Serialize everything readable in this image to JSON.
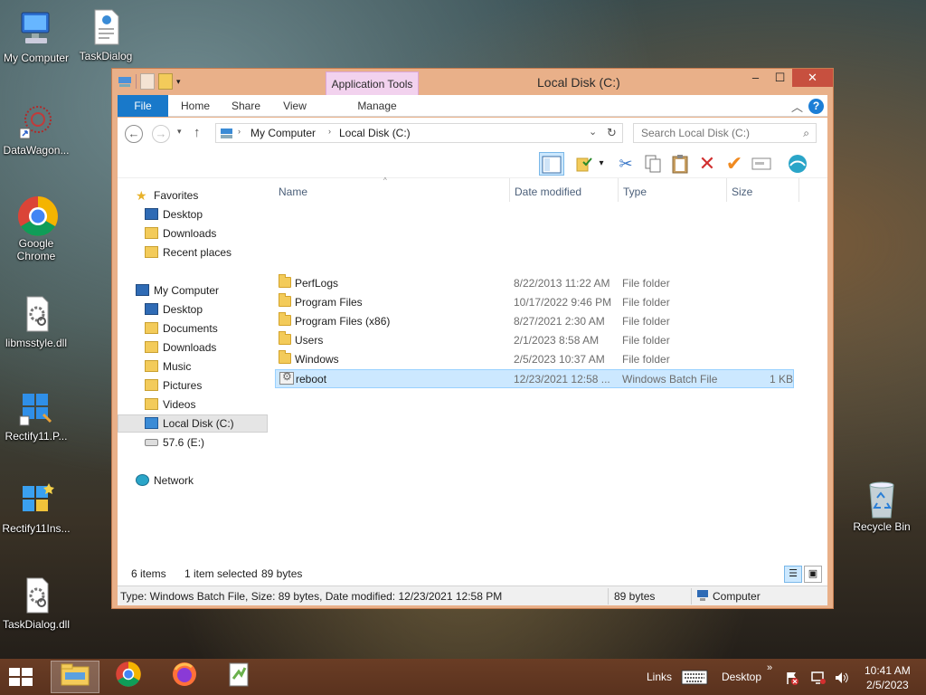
{
  "desktop": {
    "icons": [
      {
        "label": "My Computer"
      },
      {
        "label": "TaskDialog"
      },
      {
        "label": "DataWagon..."
      },
      {
        "label": "Google Chrome"
      },
      {
        "label": "libmsstyle.dll"
      },
      {
        "label": "Rectify11.P..."
      },
      {
        "label": "Rectify11Ins..."
      },
      {
        "label": "TaskDialog.dll"
      },
      {
        "label": "Recycle Bin"
      }
    ]
  },
  "window": {
    "title": "Local Disk (C:)",
    "context_tab": "Application Tools",
    "caption": {
      "minimize": "–",
      "maximize": "☐",
      "close": "✕"
    },
    "ribbon_tabs": [
      "File",
      "Home",
      "Share",
      "View",
      "Manage"
    ],
    "help": "?",
    "address": {
      "breadcrumbs": [
        "My Computer",
        "Local Disk (C:)"
      ],
      "search_placeholder": "Search Local Disk (C:)"
    },
    "columns": [
      "Name",
      "Date modified",
      "Type",
      "Size"
    ],
    "nav": {
      "favorites_header": "Favorites",
      "favorites": [
        "Desktop",
        "Downloads",
        "Recent places"
      ],
      "computer_header": "My Computer",
      "computer": [
        "Desktop",
        "Documents",
        "Downloads",
        "Music",
        "Pictures",
        "Videos",
        "Local Disk (C:)",
        "57.6 (E:)"
      ],
      "network": "Network"
    },
    "files": [
      {
        "name": "PerfLogs",
        "date": "8/22/2013 11:22 AM",
        "type": "File folder",
        "size": ""
      },
      {
        "name": "Program Files",
        "date": "10/17/2022 9:46 PM",
        "type": "File folder",
        "size": ""
      },
      {
        "name": "Program Files (x86)",
        "date": "8/27/2021 2:30 AM",
        "type": "File folder",
        "size": ""
      },
      {
        "name": "Users",
        "date": "2/1/2023 8:58 AM",
        "type": "File folder",
        "size": ""
      },
      {
        "name": "Windows",
        "date": "2/5/2023 10:37 AM",
        "type": "File folder",
        "size": ""
      },
      {
        "name": "reboot",
        "date": "12/23/2021 12:58 ...",
        "type": "Windows Batch File",
        "size": "1 KB"
      }
    ],
    "status": {
      "count": "6 items",
      "selected": "1 item selected",
      "selected_size": "89 bytes"
    },
    "details": {
      "text": "Type: Windows Batch File, Size: 89 bytes, Date modified: 12/23/2021 12:58 PM",
      "size": "89 bytes",
      "location": "Computer"
    }
  },
  "taskbar": {
    "links": "Links",
    "desktop": "Desktop",
    "chevron": "»",
    "time": "10:41 AM",
    "date": "2/5/2023"
  },
  "colors": {
    "window_frame": "#e9b089",
    "file_tab": "#1979ca",
    "close_button": "#c7503f",
    "selection": "#cce8ff",
    "taskbar": "#6a3d25"
  }
}
